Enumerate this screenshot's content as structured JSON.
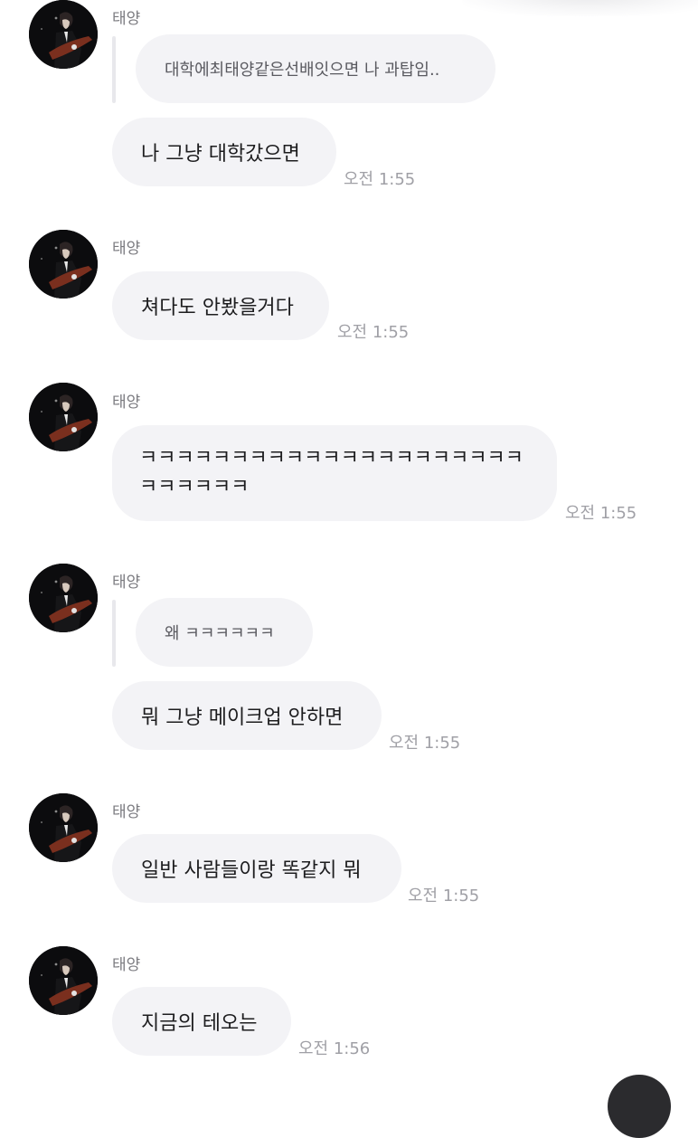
{
  "messages": [
    {
      "sender": "태양",
      "quote": "대학에최태양같은선배잇으면 나 과탑임..",
      "text": "나 그냥 대학갔으면",
      "time": "오전 1:55"
    },
    {
      "sender": "태양",
      "text": "쳐다도 안봤을거다",
      "time": "오전 1:55"
    },
    {
      "sender": "태양",
      "text": "ㅋㅋㅋㅋㅋㅋㅋㅋㅋㅋㅋㅋㅋㅋㅋㅋㅋㅋㅋㅋㅋㅋㅋㅋㅋㅋㅋ",
      "time": "오전 1:55"
    },
    {
      "sender": "태양",
      "quote": "왜 ㅋㅋㅋㅋㅋㅋ",
      "text": "뭐 그냥 메이크업 안하면",
      "time": "오전 1:55"
    },
    {
      "sender": "태양",
      "text": "일반 사람들이랑 똑같지 뭐",
      "time": "오전 1:55"
    },
    {
      "sender": "태양",
      "text": "지금의 테오는",
      "time": "오전 1:56"
    }
  ],
  "avatar_icon": "profile-photo",
  "colors": {
    "bubble": "#f3f3f6",
    "text": "#1d1d1f",
    "time": "#a0a0a6",
    "sender": "#7b7b80"
  }
}
